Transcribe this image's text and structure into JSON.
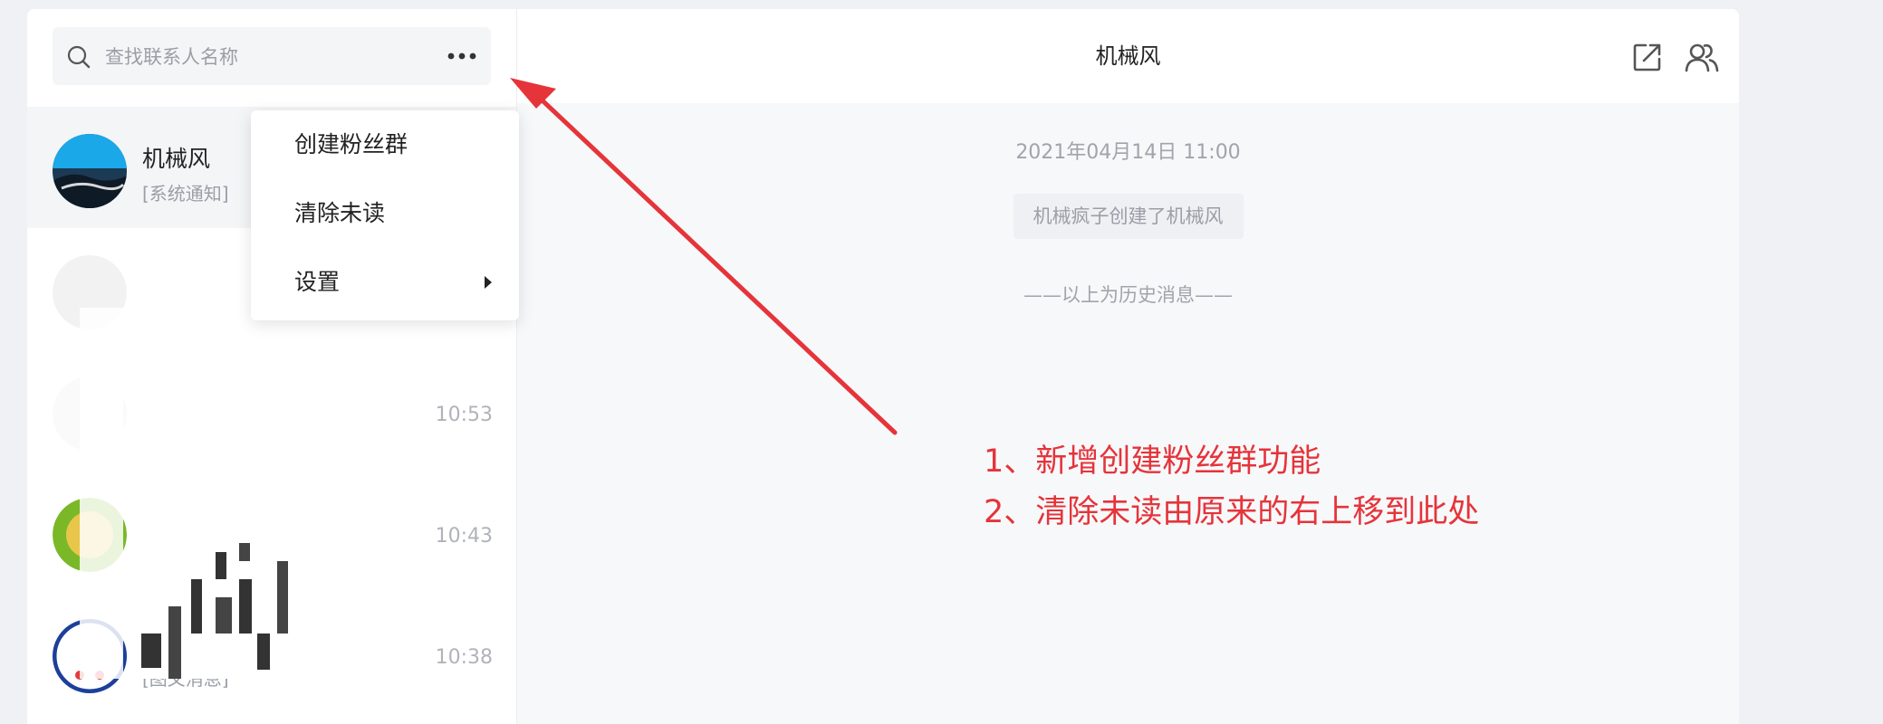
{
  "sidebar": {
    "search": {
      "placeholder": "查找联系人名称"
    },
    "more_label": "•••",
    "contacts": [
      {
        "name": "机械风",
        "preview": "[系统通知]",
        "time": ""
      },
      {
        "name": "",
        "preview": "",
        "time": ""
      },
      {
        "name": "",
        "preview": "",
        "time": "10:53"
      },
      {
        "name": "",
        "preview": "",
        "time": "10:43"
      },
      {
        "name": "",
        "preview": "[图文消息]",
        "time": "10:38"
      }
    ]
  },
  "dropdown": {
    "items": [
      {
        "label": "创建粉丝群"
      },
      {
        "label": "清除未读"
      },
      {
        "label": "设置"
      }
    ]
  },
  "chat": {
    "title": "机械风",
    "date": "2021年04月14日 11:00",
    "system_message": "机械疯子创建了机械风",
    "history_divider": "——以上为历史消息——",
    "header_icons": [
      "share-icon",
      "group-members-icon"
    ]
  },
  "annotation": {
    "line1": "1、新增创建粉丝群功能",
    "line2": "2、清除未读由原来的右上移到此处"
  },
  "colors": {
    "annotation": "#e5343a",
    "sidebar_active": "#f4f5f7",
    "chat_background": "#f7f8fa"
  }
}
